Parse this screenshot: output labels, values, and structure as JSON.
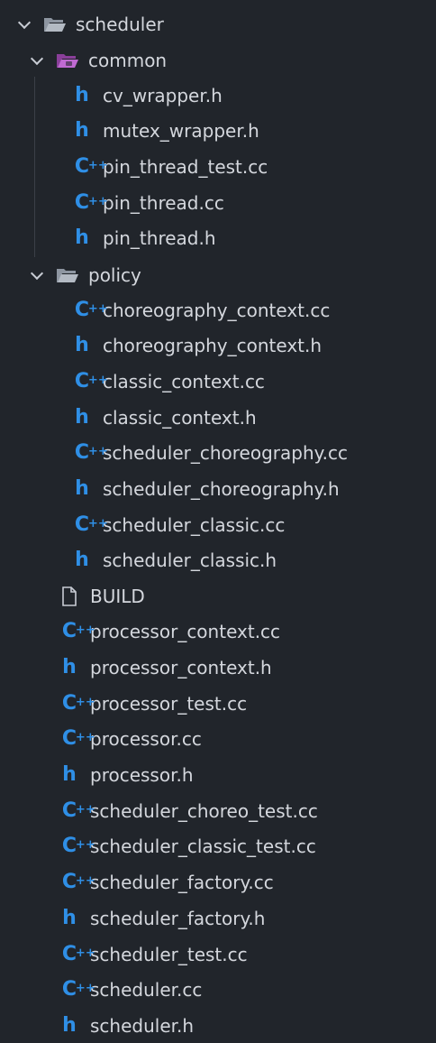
{
  "explorer": {
    "root": {
      "label": "scheduler",
      "expanded": true,
      "icon": "folder-open-icon"
    },
    "common": {
      "label": "common",
      "expanded": true,
      "icon": "folder-special-icon",
      "files": [
        {
          "name": "cv_wrapper.h",
          "type": "h"
        },
        {
          "name": "mutex_wrapper.h",
          "type": "h"
        },
        {
          "name": "pin_thread_test.cc",
          "type": "cpp"
        },
        {
          "name": "pin_thread.cc",
          "type": "cpp"
        },
        {
          "name": "pin_thread.h",
          "type": "h"
        }
      ]
    },
    "policy": {
      "label": "policy",
      "expanded": true,
      "icon": "folder-open-icon",
      "files": [
        {
          "name": "choreography_context.cc",
          "type": "cpp"
        },
        {
          "name": "choreography_context.h",
          "type": "h"
        },
        {
          "name": "classic_context.cc",
          "type": "cpp"
        },
        {
          "name": "classic_context.h",
          "type": "h"
        },
        {
          "name": "scheduler_choreography.cc",
          "type": "cpp"
        },
        {
          "name": "scheduler_choreography.h",
          "type": "h"
        },
        {
          "name": "scheduler_classic.cc",
          "type": "cpp"
        },
        {
          "name": "scheduler_classic.h",
          "type": "h"
        }
      ]
    },
    "root_files": [
      {
        "name": "BUILD",
        "type": "file"
      },
      {
        "name": "processor_context.cc",
        "type": "cpp"
      },
      {
        "name": "processor_context.h",
        "type": "h"
      },
      {
        "name": "processor_test.cc",
        "type": "cpp"
      },
      {
        "name": "processor.cc",
        "type": "cpp"
      },
      {
        "name": "processor.h",
        "type": "h"
      },
      {
        "name": "scheduler_choreo_test.cc",
        "type": "cpp"
      },
      {
        "name": "scheduler_classic_test.cc",
        "type": "cpp"
      },
      {
        "name": "scheduler_factory.cc",
        "type": "cpp"
      },
      {
        "name": "scheduler_factory.h",
        "type": "h"
      },
      {
        "name": "scheduler_test.cc",
        "type": "cpp"
      },
      {
        "name": "scheduler.cc",
        "type": "cpp"
      },
      {
        "name": "scheduler.h",
        "type": "h"
      }
    ],
    "colors": {
      "background": "#21252b",
      "icon_blue": "#2f8fe6",
      "folder_grey": "#9aa2ad",
      "folder_special": "#b55fc7",
      "text": "#d4d7dd"
    }
  }
}
